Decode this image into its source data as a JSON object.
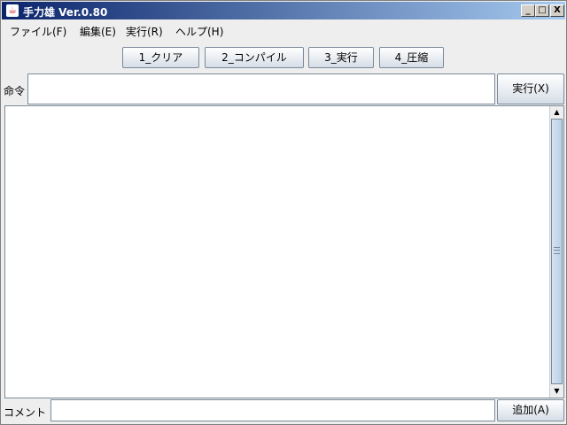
{
  "window": {
    "title": "手力雄 Ver.0.80",
    "app_icon": "java-coffee-icon",
    "controls": {
      "minimize": "_",
      "maximize": "□",
      "close": "X"
    }
  },
  "menu": [
    {
      "label": "ファイル(F)"
    },
    {
      "label": "編集(E)"
    },
    {
      "label": "実行(R)"
    },
    {
      "label": "ヘルプ(H)"
    }
  ],
  "toolbar": [
    {
      "label": "1_クリア"
    },
    {
      "label": "2_コンパイル"
    },
    {
      "label": "3_実行"
    },
    {
      "label": "4_圧縮"
    }
  ],
  "command": {
    "label": "命令",
    "value": "",
    "button": "実行(X)"
  },
  "output": {
    "value": ""
  },
  "comment": {
    "label": "コメント",
    "value": "",
    "button": "追加(A)"
  }
}
